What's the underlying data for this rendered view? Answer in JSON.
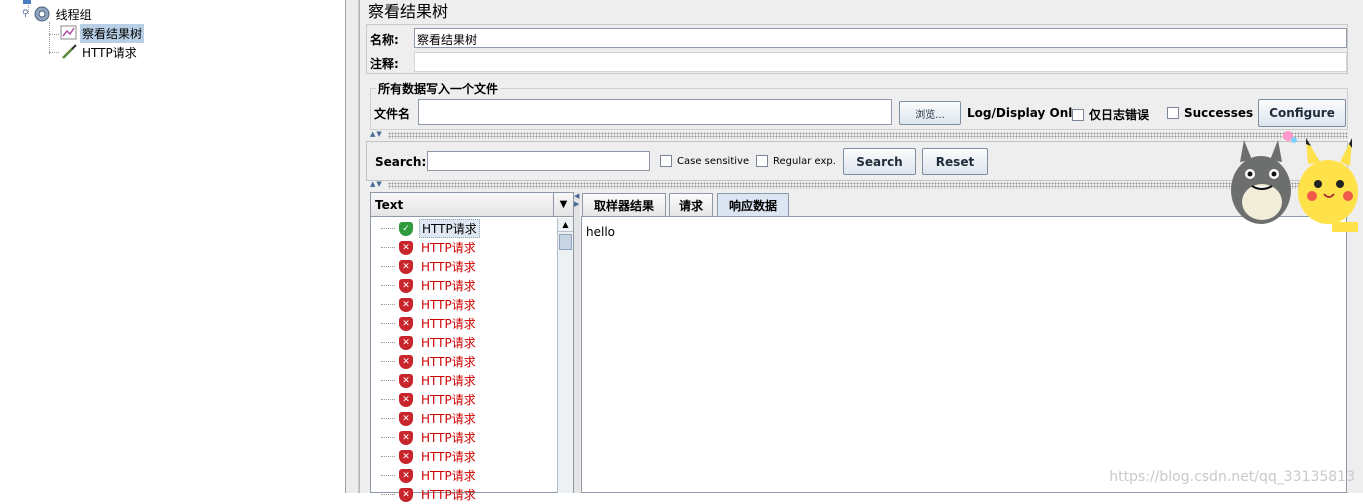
{
  "tree": {
    "items": [
      {
        "label": "线程组",
        "icon": "gear-icon"
      },
      {
        "label": "察看结果树",
        "icon": "chart-icon"
      },
      {
        "label": "HTTP请求",
        "icon": "pipette-icon"
      }
    ]
  },
  "panel": {
    "title": "察看结果树",
    "name_label": "名称:",
    "name_value": "察看结果树",
    "comment_label": "注释:",
    "comment_value": "",
    "file_group_title": "所有数据写入一个文件",
    "filename_label": "文件名",
    "filename_value": "",
    "browse_label": "浏览...",
    "log_display_label": "Log/Display Only:",
    "errors_only_label": "仅日志错误",
    "successes_label": "Successes",
    "configure_label": "Configure"
  },
  "search": {
    "label": "Search:",
    "value": "",
    "case_sensitive_label": "Case sensitive",
    "regex_label": "Regular exp.",
    "search_button": "Search",
    "reset_button": "Reset"
  },
  "results": {
    "header": "Text",
    "rows": [
      {
        "label": "HTTP请求",
        "status": "success"
      },
      {
        "label": "HTTP请求",
        "status": "error"
      },
      {
        "label": "HTTP请求",
        "status": "error"
      },
      {
        "label": "HTTP请求",
        "status": "error"
      },
      {
        "label": "HTTP请求",
        "status": "error"
      },
      {
        "label": "HTTP请求",
        "status": "error"
      },
      {
        "label": "HTTP请求",
        "status": "error"
      },
      {
        "label": "HTTP请求",
        "status": "error"
      },
      {
        "label": "HTTP请求",
        "status": "error"
      },
      {
        "label": "HTTP请求",
        "status": "error"
      },
      {
        "label": "HTTP请求",
        "status": "error"
      },
      {
        "label": "HTTP请求",
        "status": "error"
      },
      {
        "label": "HTTP请求",
        "status": "error"
      },
      {
        "label": "HTTP请求",
        "status": "error"
      },
      {
        "label": "HTTP请求",
        "status": "error"
      }
    ]
  },
  "tabs": [
    {
      "label": "取样器结果",
      "active": false
    },
    {
      "label": "请求",
      "active": false
    },
    {
      "label": "响应数据",
      "active": true
    }
  ],
  "response": {
    "body": "hello"
  },
  "watermark": "https://blog.csdn.net/qq_33135813",
  "colors": {
    "success": "#2e9b3f",
    "error": "#c9252c",
    "error_text": "#d00000",
    "selection": "#b8cfe5"
  }
}
